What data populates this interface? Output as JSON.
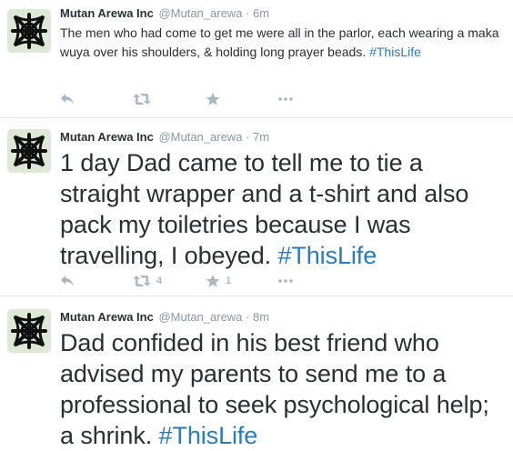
{
  "tweets": [
    {
      "fullname": "Mutan Arewa Inc",
      "username": "@Mutan_arewa",
      "separator": "·",
      "time": "6m",
      "text": "The men who had come to get me were all in the parlor, each wearing a maka wuya over his shoulders, & holding long prayer beads. ",
      "hashtag": "#ThisLife",
      "retweet_count": "",
      "favorite_count": ""
    },
    {
      "fullname": "Mutan Arewa Inc",
      "username": "@Mutan_arewa",
      "separator": "·",
      "time": "7m",
      "text": "1 day Dad came to tell me to tie a straight wrapper and a t-shirt and also pack my toiletries because I was travelling, I obeyed. ",
      "hashtag": "#ThisLife",
      "retweet_count": "4",
      "favorite_count": "1"
    },
    {
      "fullname": "Mutan Arewa Inc",
      "username": "@Mutan_arewa",
      "separator": "·",
      "time": "8m",
      "text": "Dad confided in his best friend who advised my parents to send me to a professional to seek psychological help; a shrink. ",
      "hashtag": "#ThisLife",
      "retweet_count": "",
      "favorite_count": ""
    }
  ],
  "icons": {
    "reply": "reply-icon",
    "retweet": "retweet-icon",
    "favorite": "star-icon",
    "more": "more-icon",
    "avatar": "knot-logo"
  },
  "colors": {
    "hashtag": "#2b7bb9",
    "meta": "#8899a6",
    "action": "#aab8c2",
    "avatar_bg": "#dde9d6"
  }
}
